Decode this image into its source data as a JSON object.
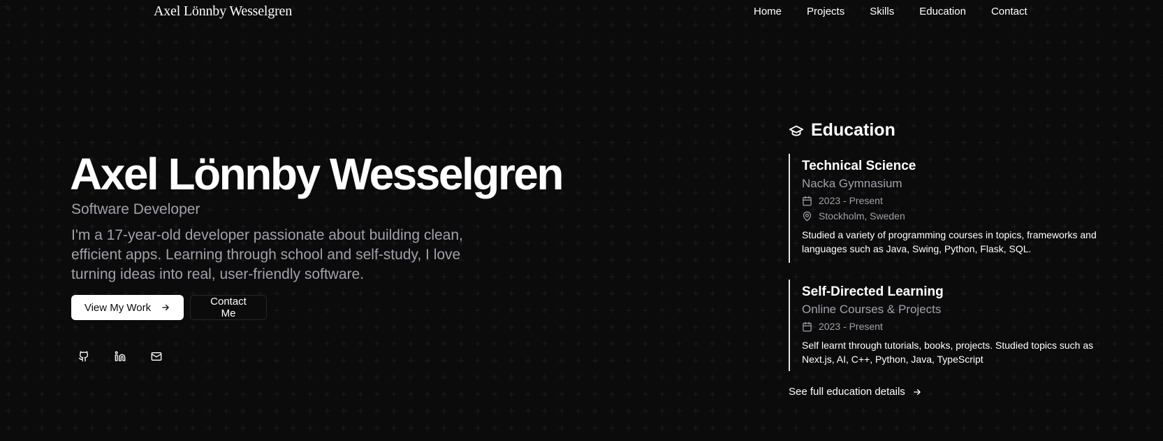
{
  "nav": {
    "brand": "Axel Lönnby Wesselgren",
    "links": [
      "Home",
      "Projects",
      "Skills",
      "Education",
      "Contact"
    ]
  },
  "hero": {
    "name": "Axel Lönnby Wesselgren",
    "role": "Software Developer",
    "description": "I'm a 17-year-old developer passionate about building clean, efficient apps. Learning through school and self-study, I love turning ideas into real, user-friendly software.",
    "primary_button": "View My Work",
    "secondary_button": "Contact Me",
    "socials": [
      "github-icon",
      "linkedin-icon",
      "mail-icon"
    ]
  },
  "education": {
    "title": "Education",
    "items": [
      {
        "degree": "Technical Science",
        "school": "Nacka Gymnasium",
        "dates": "2023 - Present",
        "location": "Stockholm, Sweden",
        "description": "Studied a variety of programming courses in topics, frameworks and languages such as Java, Swing, Python, Flask, SQL."
      },
      {
        "degree": "Self-Directed Learning",
        "school": "Online Courses & Projects",
        "dates": "2023 - Present",
        "description": "Self learnt through tutorials, books, projects. Studied topics such as Next.js, AI, C++, Python, Java, TypeScript"
      }
    ],
    "link": "See full education details"
  },
  "colors": {
    "background": "#0b0b0c",
    "text": "#ffffff",
    "muted": "#a1a1aa",
    "border": "#27272a"
  }
}
